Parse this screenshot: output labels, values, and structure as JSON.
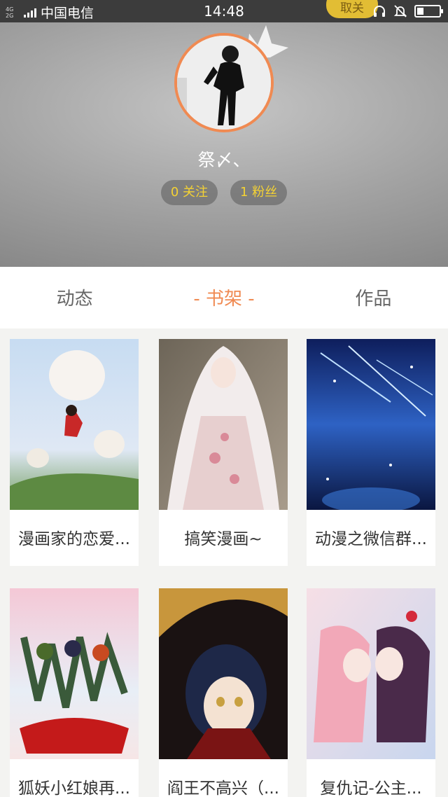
{
  "status_bar": {
    "network": [
      "4G",
      "4G",
      "2G"
    ],
    "carrier": "中国电信",
    "time": "14:48",
    "follow_button": "取关",
    "icons": [
      "headphones-icon",
      "bell-off-icon",
      "battery-icon"
    ],
    "battery_level": 0.3
  },
  "profile": {
    "username": "祭〆、",
    "following": "0 关注",
    "fans": "1 粉丝",
    "accent_color": "#f08a52"
  },
  "tabs": [
    {
      "label": "动态",
      "active": false
    },
    {
      "label": "书架",
      "active": true
    },
    {
      "label": "作品",
      "active": false
    }
  ],
  "books": [
    {
      "title": "漫画家的恋爱...",
      "cover_colors": [
        "#b8d2ec",
        "#7fa86a"
      ]
    },
    {
      "title": "搞笑漫画~",
      "cover_colors": [
        "#8a8070",
        "#e8dcdc"
      ]
    },
    {
      "title": "动漫之微信群...",
      "cover_colors": [
        "#0d1f5a",
        "#3e7bd6"
      ]
    },
    {
      "title": "狐妖小红娘再...",
      "cover_colors": [
        "#f0c6d4",
        "#b22020"
      ]
    },
    {
      "title": "阎王不高兴（...",
      "cover_colors": [
        "#1a1010",
        "#c89840"
      ]
    },
    {
      "title": "复仇记-公主...",
      "cover_colors": [
        "#f4d0d8",
        "#6a5aa0"
      ]
    }
  ]
}
